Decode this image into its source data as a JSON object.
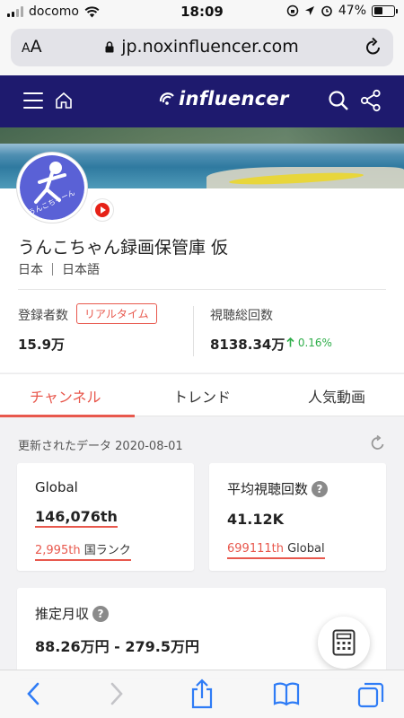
{
  "status": {
    "carrier": "docomo",
    "time": "18:09",
    "battery": "47%",
    "battery_level": 0.47
  },
  "browser": {
    "aa_label": "AA",
    "url": "jp.noxinfluencer.com"
  },
  "site": {
    "logo": "influencer"
  },
  "channel": {
    "name": "うんこちゃん録画保管庫 仮",
    "country": "日本",
    "language": "日本語",
    "avatar_text": "うんこちゃーん"
  },
  "stats": {
    "subscribers_label": "登録者数",
    "realtime_badge": "リアルタイム",
    "subscribers_value": "15.9万",
    "total_views_label": "視聴総回数",
    "total_views_value": "8138.34万",
    "growth": "0.16%"
  },
  "tabs": [
    {
      "label": "チャンネル",
      "active": true
    },
    {
      "label": "トレンド",
      "active": false
    },
    {
      "label": "人気動画",
      "active": false
    }
  ],
  "updated": {
    "label": "更新されたデータ",
    "date": "2020-08-01"
  },
  "cards": {
    "global": {
      "title": "Global",
      "value": "146,076th",
      "sub_rank": "2,995th",
      "sub_label": "国ランク"
    },
    "avg_views": {
      "title": "平均視聴回数",
      "value": "41.12K",
      "sub_rank": "699111th",
      "sub_label": "Global"
    },
    "monthly": {
      "title": "推定月収",
      "value": "88.26万円 - 279.5万円"
    }
  },
  "colors": {
    "accent": "#e8584d",
    "header": "#1e1a6e",
    "ios_blue": "#2f7cf6",
    "growth": "#2fae4a"
  }
}
